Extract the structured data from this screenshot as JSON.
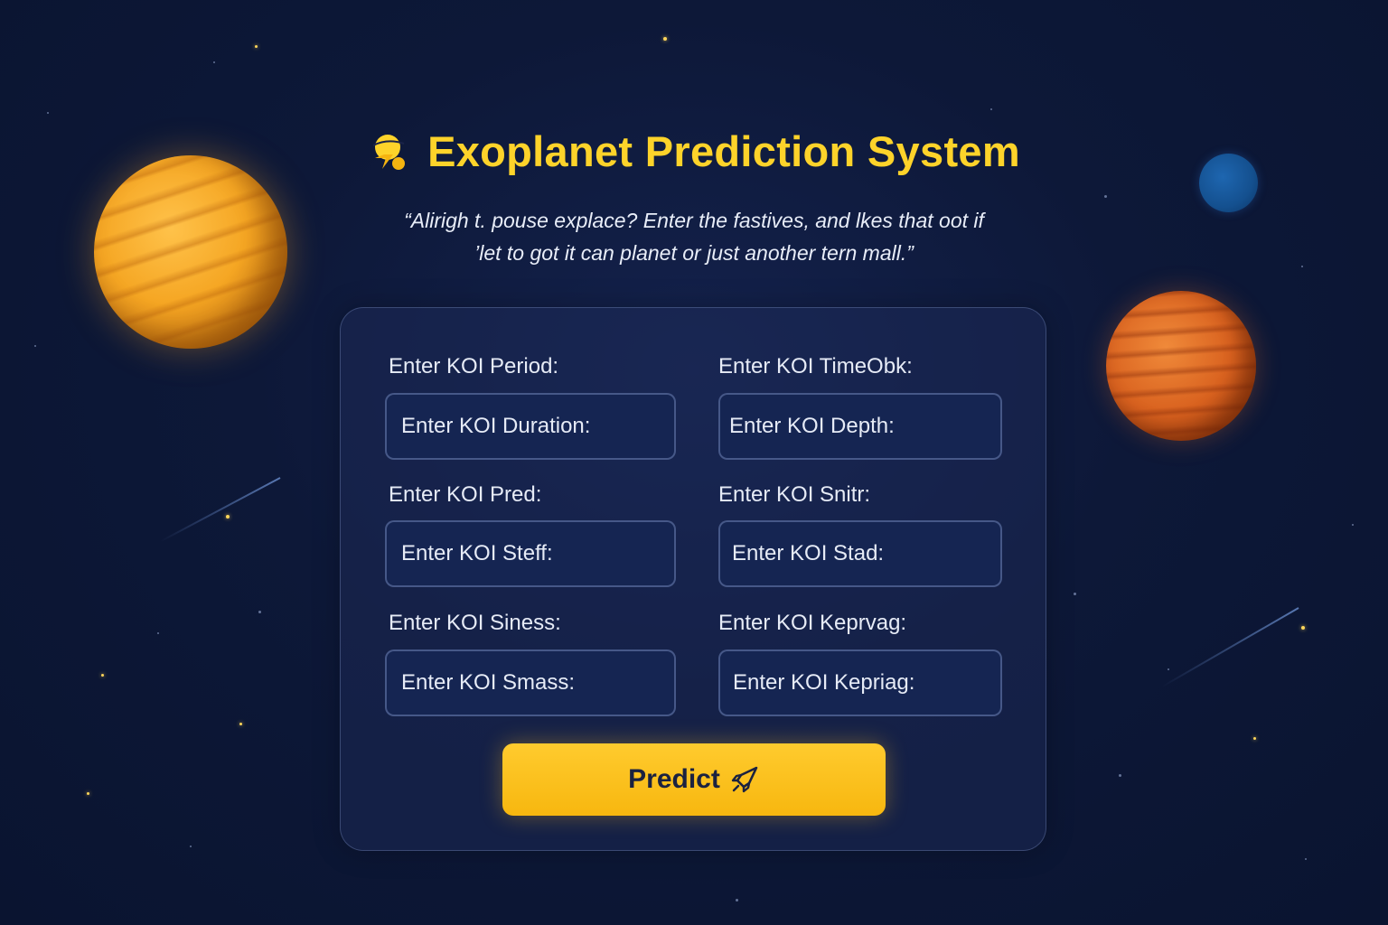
{
  "header": {
    "icon": "planet-badge-icon",
    "title": "Exoplanet Prediction System"
  },
  "subtitle": {
    "line1": "“Alirigh t. pouse explace? Enter the fastives, and lkes that oot if",
    "line2": "’let to got  it can planet or just another tern mall.”"
  },
  "form": {
    "fields": [
      {
        "label": "Enter KOI Period:",
        "placeholder": "Enter KOI Duration:"
      },
      {
        "label": "Enter KOI TimeObk:",
        "placeholder": "Enter KOI Depth:"
      },
      {
        "label": "Enter KOI Pred:",
        "placeholder": "Enter KOI Steff:"
      },
      {
        "label": "Enter KOI Snitr:",
        "placeholder": "Enter KOI Stad:"
      },
      {
        "label": "Enter KOI Siness:",
        "placeholder": "Enter KOI Smass:"
      },
      {
        "label": "Enter KOI Keprvag:",
        "placeholder": "Enter KOI Kepriag:"
      }
    ],
    "predict_label": "Predict",
    "predict_icon": "rocket-icon"
  },
  "colors": {
    "accent": "#fdd32a",
    "button": "#f9bf1b",
    "background": "#0d1838",
    "card": "#1e2c5a"
  }
}
